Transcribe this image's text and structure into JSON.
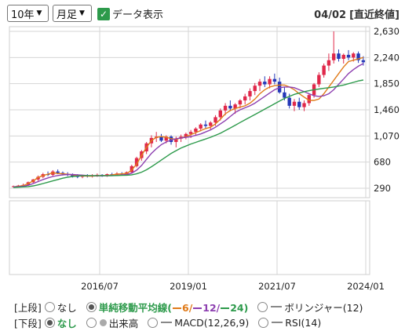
{
  "controls": {
    "period": "10年",
    "interval": "月足",
    "data_display_label": "データ表示",
    "data_display_checked": true,
    "date": "04/02",
    "date_note": "[直近終値]"
  },
  "colors": {
    "up": "#e0284a",
    "down": "#2438b8",
    "ma6": "#e07b1a",
    "ma12": "#8d3fb0",
    "ma24": "#2d9a4b",
    "grid": "#d5d5d5",
    "accent": "#2d9a4b"
  },
  "chart_data": {
    "type": "candlestick",
    "y_ticks": [
      "2,630",
      "2,240",
      "1,850",
      "1,460",
      "1,070",
      "680",
      "290"
    ],
    "y_tick_values": [
      2630,
      2240,
      1850,
      1460,
      1070,
      680,
      290
    ],
    "ylim": [
      290,
      2630
    ],
    "x_ticks": [
      "2016/07",
      "2019/01",
      "2021/07",
      "2024/01"
    ],
    "series": [
      {
        "name": "6",
        "values": [
          310,
          320,
          330,
          360,
          400,
          450,
          480,
          500,
          520,
          510,
          505,
          500,
          490,
          480,
          475,
          470,
          470,
          475,
          480,
          480,
          490,
          500,
          505,
          510,
          560,
          650,
          780,
          900,
          1000,
          1050,
          1060,
          1050,
          1030,
          1020,
          1040,
          1060,
          1090,
          1120,
          1150,
          1180,
          1200,
          1250,
          1320,
          1400,
          1450,
          1480,
          1500,
          1520,
          1560,
          1620,
          1700,
          1760,
          1800,
          1820,
          1830,
          1830,
          1800,
          1760,
          1700,
          1650,
          1600,
          1600,
          1620,
          1700,
          1800,
          1900,
          2000,
          2100,
          2180,
          2200,
          2220,
          2240
        ]
      },
      {
        "name": "12",
        "values": [
          310,
          315,
          320,
          335,
          360,
          390,
          420,
          445,
          465,
          480,
          490,
          495,
          495,
          490,
          485,
          480,
          478,
          475,
          475,
          476,
          478,
          482,
          488,
          495,
          515,
          560,
          630,
          720,
          810,
          880,
          940,
          980,
          1010,
          1030,
          1040,
          1050,
          1060,
          1080,
          1100,
          1130,
          1160,
          1200,
          1250,
          1300,
          1360,
          1420,
          1460,
          1490,
          1520,
          1560,
          1610,
          1660,
          1710,
          1760,
          1790,
          1800,
          1800,
          1790,
          1760,
          1730,
          1700,
          1670,
          1660,
          1670,
          1700,
          1760,
          1840,
          1920,
          2000,
          2060,
          2110,
          2150
        ]
      },
      {
        "name": "24",
        "values": [
          300,
          305,
          310,
          315,
          325,
          340,
          360,
          380,
          400,
          420,
          440,
          455,
          465,
          472,
          476,
          478,
          478,
          478,
          478,
          478,
          478,
          480,
          482,
          484,
          490,
          505,
          530,
          565,
          610,
          660,
          710,
          760,
          810,
          850,
          890,
          920,
          950,
          975,
          1000,
          1025,
          1050,
          1080,
          1110,
          1150,
          1190,
          1230,
          1270,
          1310,
          1350,
          1390,
          1430,
          1470,
          1510,
          1550,
          1590,
          1630,
          1660,
          1690,
          1710,
          1730,
          1745,
          1760,
          1770,
          1780,
          1790,
          1800,
          1815,
          1830,
          1850,
          1870,
          1890,
          1905
        ]
      }
    ],
    "candles_ohlc": [
      [
        310,
        330,
        300,
        320
      ],
      [
        320,
        340,
        310,
        330
      ],
      [
        330,
        360,
        320,
        340
      ],
      [
        340,
        390,
        330,
        380
      ],
      [
        380,
        430,
        370,
        420
      ],
      [
        420,
        480,
        400,
        460
      ],
      [
        460,
        520,
        440,
        500
      ],
      [
        500,
        540,
        470,
        490
      ],
      [
        490,
        560,
        470,
        540
      ],
      [
        540,
        570,
        500,
        520
      ],
      [
        520,
        540,
        480,
        500
      ],
      [
        500,
        530,
        470,
        490
      ],
      [
        490,
        510,
        450,
        470
      ],
      [
        470,
        500,
        440,
        460
      ],
      [
        460,
        490,
        440,
        480
      ],
      [
        480,
        500,
        450,
        470
      ],
      [
        470,
        500,
        450,
        480
      ],
      [
        480,
        510,
        460,
        490
      ],
      [
        490,
        500,
        460,
        470
      ],
      [
        470,
        510,
        460,
        500
      ],
      [
        500,
        520,
        480,
        490
      ],
      [
        490,
        530,
        480,
        510
      ],
      [
        510,
        530,
        490,
        500
      ],
      [
        500,
        540,
        490,
        530
      ],
      [
        530,
        640,
        520,
        620
      ],
      [
        620,
        760,
        600,
        740
      ],
      [
        740,
        860,
        700,
        840
      ],
      [
        840,
        980,
        800,
        960
      ],
      [
        960,
        1080,
        900,
        1040
      ],
      [
        1040,
        1130,
        980,
        1060
      ],
      [
        1060,
        1100,
        980,
        1000
      ],
      [
        1000,
        1080,
        960,
        1060
      ],
      [
        1060,
        1080,
        940,
        980
      ],
      [
        980,
        1060,
        900,
        1030
      ],
      [
        1030,
        1090,
        980,
        1060
      ],
      [
        1060,
        1120,
        1020,
        1100
      ],
      [
        1100,
        1160,
        1040,
        1130
      ],
      [
        1130,
        1200,
        1080,
        1180
      ],
      [
        1180,
        1260,
        1140,
        1240
      ],
      [
        1240,
        1300,
        1180,
        1220
      ],
      [
        1220,
        1290,
        1160,
        1270
      ],
      [
        1270,
        1380,
        1220,
        1350
      ],
      [
        1350,
        1480,
        1300,
        1450
      ],
      [
        1450,
        1560,
        1380,
        1520
      ],
      [
        1520,
        1600,
        1440,
        1480
      ],
      [
        1480,
        1560,
        1400,
        1540
      ],
      [
        1540,
        1620,
        1480,
        1600
      ],
      [
        1600,
        1700,
        1540,
        1660
      ],
      [
        1660,
        1780,
        1600,
        1740
      ],
      [
        1740,
        1860,
        1680,
        1820
      ],
      [
        1820,
        1920,
        1740,
        1880
      ],
      [
        1880,
        1960,
        1800,
        1840
      ],
      [
        1840,
        1960,
        1780,
        1920
      ],
      [
        1920,
        2000,
        1840,
        1880
      ],
      [
        1880,
        1940,
        1700,
        1720
      ],
      [
        1720,
        1800,
        1600,
        1640
      ],
      [
        1640,
        1700,
        1480,
        1520
      ],
      [
        1520,
        1620,
        1440,
        1580
      ],
      [
        1580,
        1640,
        1460,
        1500
      ],
      [
        1500,
        1600,
        1440,
        1560
      ],
      [
        1560,
        1700,
        1520,
        1680
      ],
      [
        1680,
        1860,
        1640,
        1840
      ],
      [
        1840,
        2020,
        1800,
        1980
      ],
      [
        1980,
        2150,
        1940,
        2120
      ],
      [
        2120,
        2300,
        2040,
        2200
      ],
      [
        2200,
        2630,
        2150,
        2300
      ],
      [
        2300,
        2360,
        2180,
        2220
      ],
      [
        2220,
        2300,
        2150,
        2280
      ],
      [
        2280,
        2350,
        2200,
        2240
      ],
      [
        2240,
        2320,
        2180,
        2300
      ],
      [
        2300,
        2330,
        2160,
        2200
      ],
      [
        2200,
        2260,
        2120,
        2170
      ]
    ]
  },
  "legend": {
    "upper_label": "[上段]",
    "lower_label": "[下段]",
    "upper_options": [
      {
        "label": "なし",
        "selected": false
      },
      {
        "label": "単純移動平均線(",
        "selected": true
      },
      {
        "label": "ボリンジャー(12)",
        "selected": false
      }
    ],
    "ma_parts": [
      "6/",
      "12/",
      "24",
      ")"
    ],
    "lower_options": [
      {
        "label": "なし",
        "selected": true
      },
      {
        "label": "出来高",
        "selected": false
      },
      {
        "label": "MACD(12,26,9)",
        "selected": false
      },
      {
        "label": "RSI(14)",
        "selected": false
      }
    ]
  }
}
